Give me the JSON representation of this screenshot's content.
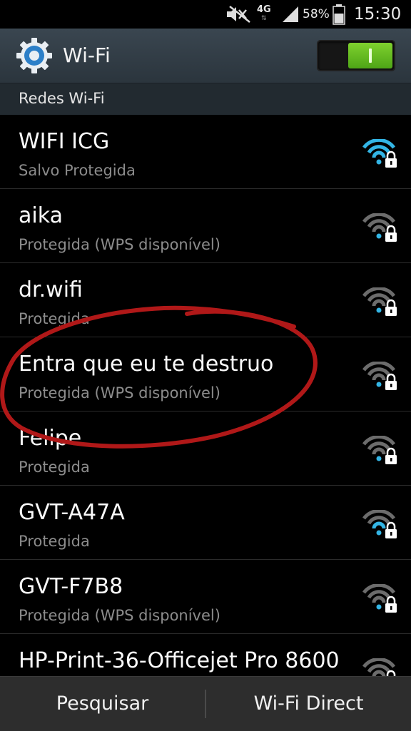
{
  "status_bar": {
    "network_type": "4G",
    "battery_percent": "58%",
    "time": "15:30",
    "icons": [
      "mute-icon",
      "4g-icon",
      "signal-icon",
      "battery-icon"
    ]
  },
  "header": {
    "title": "Wi-Fi",
    "toggle_on": true,
    "icon": "gear-icon",
    "accent": "#5cb81e"
  },
  "section": {
    "label": "Redes Wi-Fi"
  },
  "networks": [
    {
      "name": "WIFI  ICG",
      "status": "Salvo Protegida",
      "signal": "strong",
      "locked": true
    },
    {
      "name": "aika",
      "status": "Protegida (WPS disponível)",
      "signal": "weak",
      "locked": true
    },
    {
      "name": "dr.wifi",
      "status": "Protegida",
      "signal": "weak",
      "locked": true
    },
    {
      "name": "Entra que eu te destruo",
      "status": "Protegida (WPS disponível)",
      "signal": "weak",
      "locked": true
    },
    {
      "name": "Felipe",
      "status": "Protegida",
      "signal": "weak",
      "locked": true
    },
    {
      "name": "GVT-A47A",
      "status": "Protegida",
      "signal": "medium",
      "locked": true
    },
    {
      "name": "GVT-F7B8",
      "status": "Protegida (WPS disponível)",
      "signal": "weak",
      "locked": true
    },
    {
      "name": "HP-Print-36-Officejet Pro 8600",
      "status": "",
      "signal": "weak",
      "locked": true
    }
  ],
  "bottom_bar": {
    "left_label": "Pesquisar",
    "right_label": "Wi-Fi Direct"
  },
  "colors": {
    "wifi_active": "#33b5e5",
    "wifi_inactive": "#6c6c6c",
    "annotation": "#b01818"
  }
}
